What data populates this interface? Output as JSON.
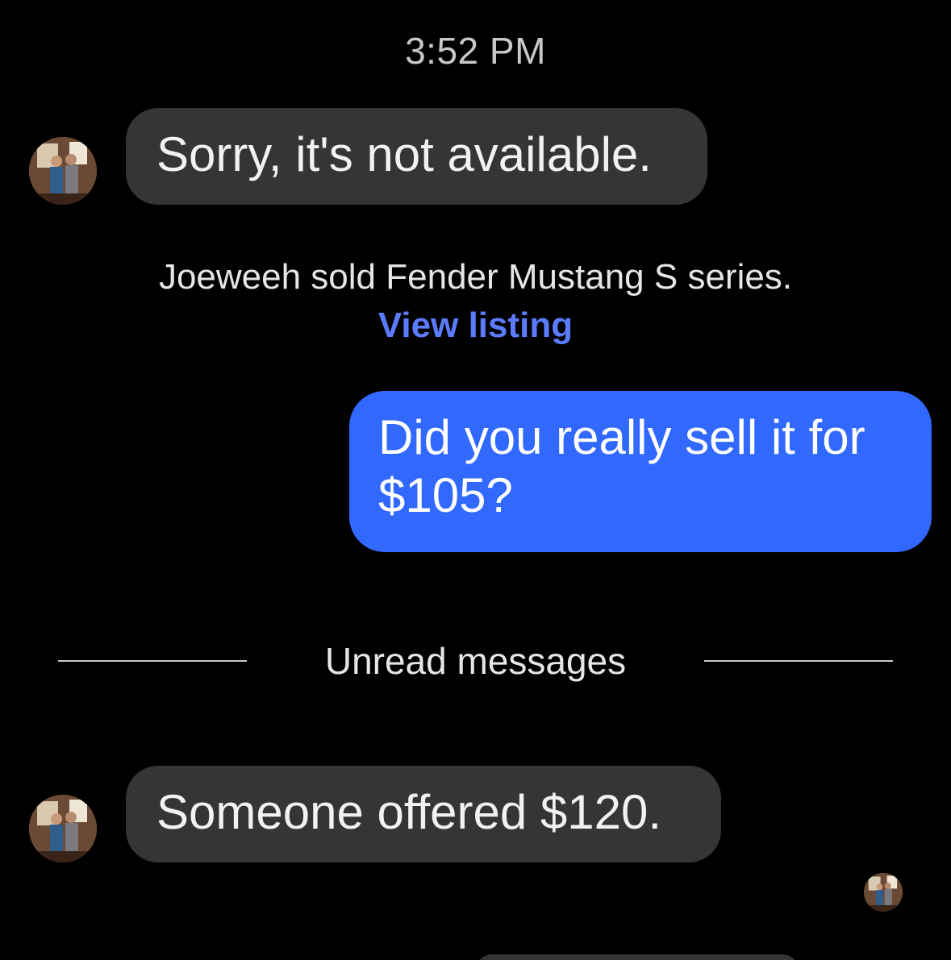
{
  "header": {
    "timestamp": "3:52 PM"
  },
  "messages": [
    {
      "direction": "incoming",
      "text": "Sorry, it's not available."
    },
    {
      "direction": "outgoing",
      "text": "Did you really sell it for $105?"
    },
    {
      "direction": "incoming",
      "text": "Someone offered $120."
    }
  ],
  "system_notice": {
    "text": "Joeweeh sold Fender Mustang S series.",
    "link_label": "View listing"
  },
  "divider": {
    "label": "Unread messages"
  },
  "icons": {
    "contact_avatar": "profile-photo",
    "read_receipt_avatar": "profile-photo"
  },
  "colors": {
    "background": "#000000",
    "incoming_bubble": "#353537",
    "outgoing_bubble": "#3168fe",
    "link": "#5b7cff"
  }
}
